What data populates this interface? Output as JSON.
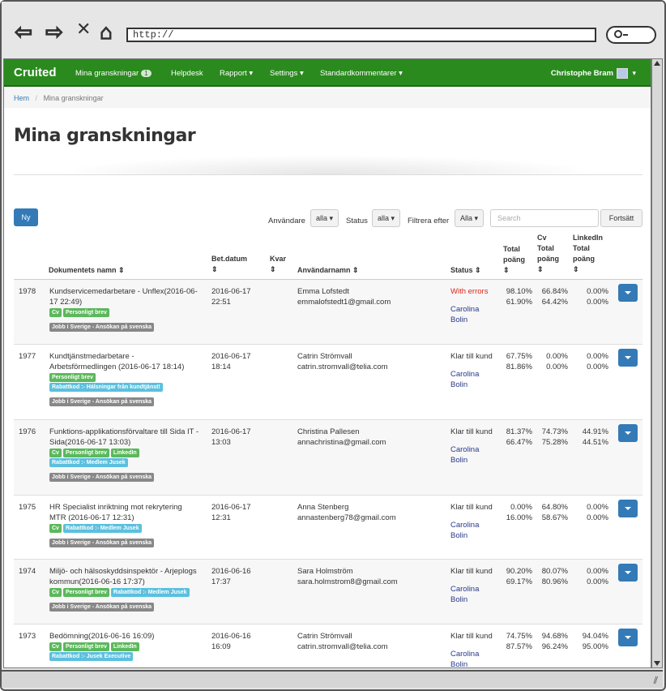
{
  "browser": {
    "url": "http://",
    "back": "⇦",
    "forward": "⇨",
    "close": "✕",
    "home": "⌂"
  },
  "nav": {
    "brand": "Cruited",
    "items": [
      "Mina granskningar",
      "Helpdesk",
      "Rapport ▾",
      "Settings ▾",
      "Standardkommentarer ▾"
    ],
    "badge": "1",
    "user": "Christophe Bram"
  },
  "breadcrumb": {
    "home": "Hem",
    "sep": "/",
    "current": "Mina granskningar"
  },
  "page": {
    "title": "Mina granskningar"
  },
  "toolbar": {
    "new": "Ny",
    "anvandare": "Användare",
    "anvandare_val": "alla ▾",
    "status": "Status",
    "status_val": "alla ▾",
    "filtrera": "Filtrera efter",
    "filtrera_val": "Alla ▾",
    "search_placeholder": "Search",
    "fortsatt": "Fortsätt"
  },
  "columns": {
    "dok": "Dokumentets namn ⇕",
    "bet": "Bet.datum",
    "kvar": "Kvar",
    "anv": "Användarnamn ⇕",
    "status": "Status ⇕",
    "tot1": "Total",
    "tot2": "poäng",
    "cv1": "Cv",
    "cv2": "Total",
    "cv3": "poäng",
    "li1": "LinkedIn",
    "li2": "Total",
    "li3": "poäng",
    "sort": "⇕"
  },
  "rows": [
    {
      "id": "1978",
      "doc1": "Kundservicemedarbetare - Unflex(2016-06-",
      "doc2": "17 22:49)",
      "tags": [
        [
          "Cv",
          "g"
        ],
        [
          "Personligt brev",
          "g"
        ]
      ],
      "tags2": [],
      "tags3": [
        [
          "Jobb i Sverige - Ansökan på svenska",
          "gr"
        ]
      ],
      "d1": "2016-06-17",
      "d2": "22:51",
      "name": "Emma Lofstedt",
      "email": "emmalofstedt1@gmail.com",
      "status": "With errors",
      "status_red": true,
      "rev1": "Carolina",
      "rev2": "Bolin",
      "t1": "98.10%",
      "t2": "61.90%",
      "c1": "66.84%",
      "c2": "64.42%",
      "l1": "0.00%",
      "l2": "0.00%"
    },
    {
      "id": "1977",
      "doc1": "Kundtjänstmedarbetare -",
      "doc2": "Arbetsförmedlingen (2016-06-17 18:14)",
      "tags": [
        [
          "Personligt brev",
          "g"
        ]
      ],
      "tags2": [
        [
          "Rabattkod :- Hälsningar från kundtjänst!",
          "lb"
        ]
      ],
      "tags3": [
        [
          "Jobb i Sverige - Ansökan på svenska",
          "gr"
        ]
      ],
      "d1": "2016-06-17",
      "d2": "18:14",
      "name": "Catrin Strömvall",
      "email": "catrin.stromvall@telia.com",
      "status": "Klar till kund",
      "status_red": false,
      "rev1": "Carolina",
      "rev2": "Bolin",
      "t1": "67.75%",
      "t2": "81.86%",
      "c1": "0.00%",
      "c2": "0.00%",
      "l1": "0.00%",
      "l2": "0.00%"
    },
    {
      "id": "1976",
      "doc1": "Funktions-applikationsförvaltare till Sida IT -",
      "doc2": "Sida(2016-06-17 13:03)",
      "tags": [
        [
          "Cv",
          "g"
        ],
        [
          "Personligt brev",
          "g"
        ],
        [
          "LinkedIn",
          "g"
        ]
      ],
      "tags2": [
        [
          "Rabattkod :- Medlem Jusek",
          "lb"
        ]
      ],
      "tags3": [
        [
          "Jobb i Sverige - Ansökan på svenska",
          "gr"
        ]
      ],
      "d1": "2016-06-17",
      "d2": "13:03",
      "name": "Christina Pallesen",
      "email": "annachristina@gmail.com",
      "status": "Klar till kund",
      "status_red": false,
      "rev1": "Carolina",
      "rev2": "Bolin",
      "t1": "81.37%",
      "t2": "66.47%",
      "c1": "74.73%",
      "c2": "75.28%",
      "l1": "44.91%",
      "l2": "44.51%"
    },
    {
      "id": "1975",
      "doc1": "HR Specialist inriktning mot rekrytering",
      "doc2": "MTR (2016-06-17 12:31)",
      "tags": [
        [
          "Cv",
          "g"
        ],
        [
          "Rabattkod :- Medlem Jusek",
          "lb"
        ]
      ],
      "tags2": [],
      "tags3": [
        [
          "Jobb i Sverige - Ansökan på svenska",
          "gr"
        ]
      ],
      "d1": "2016-06-17",
      "d2": "12:31",
      "name": "Anna Stenberg",
      "email": "annastenberg78@gmail.com",
      "status": "Klar till kund",
      "status_red": false,
      "rev1": "Carolina",
      "rev2": "Bolin",
      "t1": "0.00%",
      "t2": "16.00%",
      "c1": "64.80%",
      "c2": "58.67%",
      "l1": "0.00%",
      "l2": "0.00%"
    },
    {
      "id": "1974",
      "doc1": "Miljö- och hälsoskyddsinspektör - Arjeplogs",
      "doc2": "kommun(2016-06-16 17:37)",
      "tags": [
        [
          "Cv",
          "g"
        ],
        [
          "Personligt brev",
          "g"
        ],
        [
          "Rabattkod :- Medlem Jusek",
          "lb"
        ]
      ],
      "tags2": [],
      "tags3": [
        [
          "Jobb i Sverige - Ansökan på svenska",
          "gr"
        ]
      ],
      "d1": "2016-06-16",
      "d2": "17:37",
      "name": "Sara Holmström",
      "email": "sara.holmstrom8@gmail.com",
      "status": "Klar till kund",
      "status_red": false,
      "rev1": "Carolina",
      "rev2": "Bolin",
      "t1": "90.20%",
      "t2": "69.17%",
      "c1": "80.07%",
      "c2": "80.96%",
      "l1": "0.00%",
      "l2": "0.00%"
    },
    {
      "id": "1973",
      "doc1": "Bedömning(2016-06-16 16:09)",
      "doc2": "",
      "tags": [
        [
          "Cv",
          "g"
        ],
        [
          "Personligt brev",
          "g"
        ],
        [
          "LinkedIn",
          "g"
        ]
      ],
      "tags2": [
        [
          "Rabattkod :- Jusek Executive",
          "lb"
        ]
      ],
      "tags3": [],
      "d1": "2016-06-16",
      "d2": "16:09",
      "name": "Catrin Strömvall",
      "email": "catrin.stromvall@telia.com",
      "status": "Klar till kund",
      "status_red": false,
      "rev1": "Carolina",
      "rev2": "Bolin",
      "t1": "74.75%",
      "t2": "87.57%",
      "c1": "94.68%",
      "c2": "96.24%",
      "l1": "94.04%",
      "l2": "95.00%"
    }
  ]
}
